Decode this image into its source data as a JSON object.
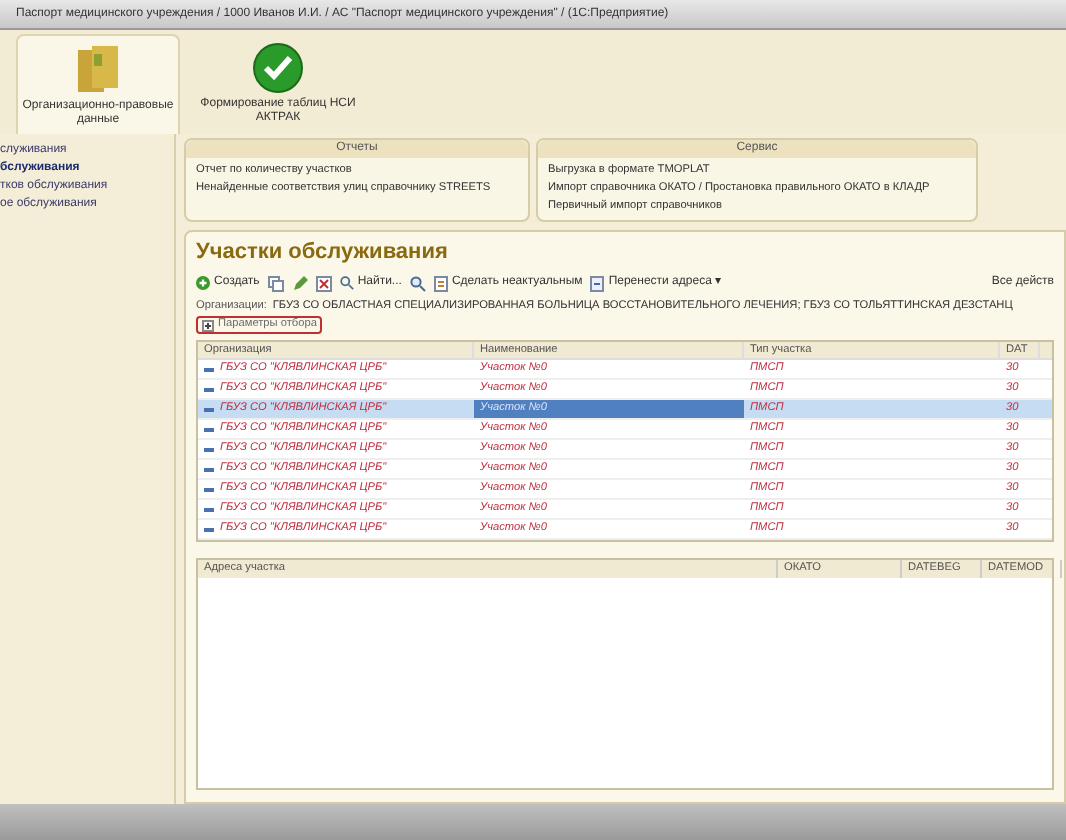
{
  "window": {
    "title": "Паспорт медицинского учреждения / 1000 Иванов И.И. / АС \"Паспорт медицинского учреждения\" / (1С:Предприятие)"
  },
  "sections": [
    {
      "kind": "folders",
      "label": "Организационно-правовые данные",
      "selected": true
    },
    {
      "kind": "check",
      "label": "Формирование таблиц НСИ АКТРАК",
      "selected": false
    }
  ],
  "sidebar": {
    "items": [
      {
        "label": "служивания",
        "selected": false
      },
      {
        "label": "бслуживания",
        "selected": true
      },
      {
        "label": "тков обслуживания",
        "selected": false
      },
      {
        "label": "ое обслуживания",
        "selected": false
      }
    ]
  },
  "panels": [
    {
      "title": "Отчеты",
      "items": [
        "Отчет по количеству участков",
        "Ненайденные соответствия улиц справочнику STREETS"
      ]
    },
    {
      "title": "Сервис",
      "items": [
        "Выгрузка в формате TMOPLAT",
        "Импорт справочника ОКАТО / Простановка правильного ОКАТО в КЛАДР",
        "Первичный импорт справочников"
      ]
    }
  ],
  "form": {
    "title": "Участки обслуживания",
    "toolbar": [
      {
        "kind": "create",
        "label": "Создать"
      },
      {
        "kind": "copy"
      },
      {
        "kind": "edit"
      },
      {
        "kind": "delete"
      },
      {
        "kind": "find",
        "label": "Найти..."
      },
      {
        "kind": "zoom"
      },
      {
        "kind": "mark",
        "label": "Сделать неактуальным"
      },
      {
        "kind": "move",
        "label": "Перенести адреса ▾"
      },
      {
        "kind": "all",
        "label": "Все действ"
      }
    ],
    "filter": {
      "label": "Организации:",
      "value": "ГБУЗ СО ОБЛАСТНАЯ СПЕЦИАЛИЗИРОВАННАЯ БОЛЬНИЦА ВОССТАНОВИТЕЛЬНОГО ЛЕЧЕНИЯ; ГБУЗ СО ТОЛЬЯТТИНСКАЯ ДЕЗСТАНЦ"
    },
    "filter_toggle": {
      "label": "Параметры отбора",
      "expanded": false
    },
    "table": {
      "columns": [
        "Организация",
        "Наименование",
        "Тип участка",
        "DAT"
      ],
      "rows": [
        {
          "cells": [
            "ГБУЗ СО \"КЛЯВЛИНСКАЯ ЦРБ\"",
            "Участок №0",
            "ПМСП",
            "30"
          ],
          "selected": false
        },
        {
          "cells": [
            "ГБУЗ СО \"КЛЯВЛИНСКАЯ ЦРБ\"",
            "Участок №0",
            "ПМСП",
            "30"
          ],
          "selected": false
        },
        {
          "cells": [
            "ГБУЗ СО \"КЛЯВЛИНСКАЯ ЦРБ\"",
            "Участок №0",
            "ПМСП",
            "30"
          ],
          "selected": true
        },
        {
          "cells": [
            "ГБУЗ СО \"КЛЯВЛИНСКАЯ ЦРБ\"",
            "Участок №0",
            "ПМСП",
            "30"
          ],
          "selected": false
        },
        {
          "cells": [
            "ГБУЗ СО \"КЛЯВЛИНСКАЯ ЦРБ\"",
            "Участок №0",
            "ПМСП",
            "30"
          ],
          "selected": false
        },
        {
          "cells": [
            "ГБУЗ СО \"КЛЯВЛИНСКАЯ ЦРБ\"",
            "Участок №0",
            "ПМСП",
            "30"
          ],
          "selected": false
        },
        {
          "cells": [
            "ГБУЗ СО \"КЛЯВЛИНСКАЯ ЦРБ\"",
            "Участок №0",
            "ПМСП",
            "30"
          ],
          "selected": false
        },
        {
          "cells": [
            "ГБУЗ СО \"КЛЯВЛИНСКАЯ ЦРБ\"",
            "Участок №0",
            "ПМСП",
            "30"
          ],
          "selected": false
        },
        {
          "cells": [
            "ГБУЗ СО \"КЛЯВЛИНСКАЯ ЦРБ\"",
            "Участок №0",
            "ПМСП",
            "30"
          ],
          "selected": false
        }
      ]
    },
    "address_table": {
      "columns": [
        "Адреса участка",
        "ОКАТО",
        "DATEBEG",
        "DATEMOD"
      ]
    }
  }
}
